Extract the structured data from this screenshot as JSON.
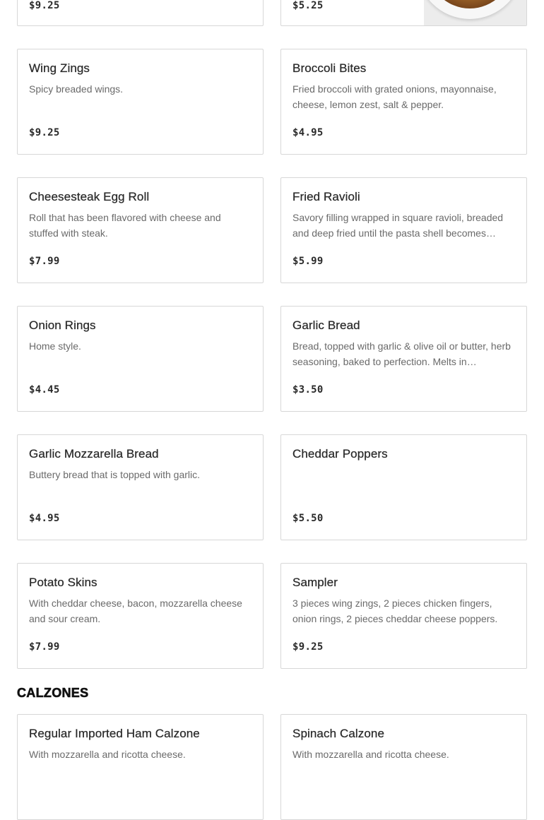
{
  "top_row": [
    {
      "price": "$9.25"
    },
    {
      "price": "$5.25",
      "image_icon": "food-photo"
    }
  ],
  "items": [
    {
      "name": "Wing Zings",
      "description": "Spicy breaded wings.",
      "price": "$9.25"
    },
    {
      "name": "Broccoli Bites",
      "description": "Fried broccoli with grated onions, mayonnaise, cheese, lemon zest, salt & pepper.",
      "price": "$4.95"
    },
    {
      "name": "Cheesesteak Egg Roll",
      "description": "Roll that has been flavored with cheese and stuffed with steak.",
      "price": "$7.99"
    },
    {
      "name": "Fried Ravioli",
      "description": "Savory filling wrapped in square ravioli, breaded and deep fried until the pasta shell becomes…",
      "price": "$5.99"
    },
    {
      "name": "Onion Rings",
      "description": "Home style.",
      "price": "$4.45"
    },
    {
      "name": "Garlic Bread",
      "description": "Bread, topped with garlic & olive oil or butter, herb seasoning, baked to perfection. Melts in…",
      "price": "$3.50"
    },
    {
      "name": "Garlic Mozzarella Bread",
      "description": "Buttery bread that is topped with garlic.",
      "price": "$4.95"
    },
    {
      "name": "Cheddar Poppers",
      "description": "",
      "price": "$5.50"
    },
    {
      "name": "Potato Skins",
      "description": "With cheddar cheese, bacon, mozzarella cheese and sour cream.",
      "price": "$7.99"
    },
    {
      "name": "Sampler",
      "description": "3 pieces wing zings, 2 pieces chicken fingers, onion rings, 2 pieces cheddar cheese poppers.",
      "price": "$9.25"
    }
  ],
  "calzones": {
    "title": "CALZONES",
    "items": [
      {
        "name": "Regular Imported Ham Calzone",
        "description": "With mozzarella and ricotta cheese.",
        "price": ""
      },
      {
        "name": "Spinach Calzone",
        "description": "With mozzarella and ricotta cheese.",
        "price": ""
      }
    ]
  }
}
